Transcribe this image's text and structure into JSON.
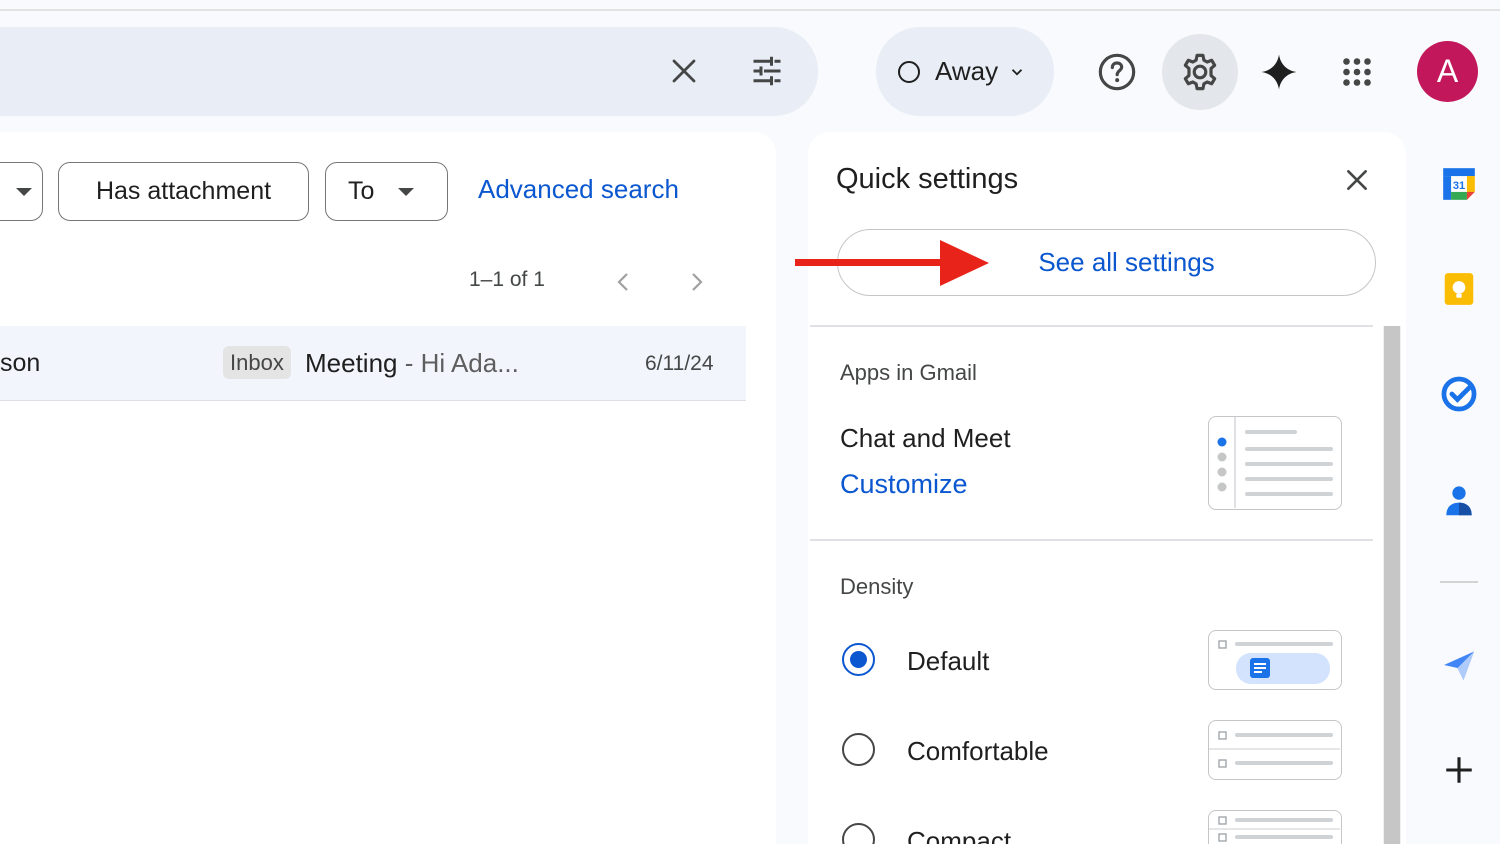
{
  "search": {
    "clear_icon": "close-icon",
    "options_icon": "tune-icon"
  },
  "status": {
    "label": "Away"
  },
  "header_icons": [
    "help-icon",
    "settings-gear-icon",
    "gemini-spark-icon",
    "apps-grid-icon"
  ],
  "account": {
    "avatar_letter": "A",
    "avatar_color": "#c2185b"
  },
  "filters": {
    "cut_chip_label": "",
    "has_attachment": "Has attachment",
    "to": "To",
    "advanced_search": "Advanced search"
  },
  "pager": {
    "text": "1–1 of 1"
  },
  "mail": {
    "sender": "son",
    "label": "Inbox",
    "subject": "Meeting",
    "snippet": " - Hi Ada...",
    "date": "6/11/24"
  },
  "quick_settings": {
    "title": "Quick settings",
    "see_all": "See all settings",
    "apps_section": "Apps in Gmail",
    "chat_meet": "Chat and Meet",
    "customize": "Customize",
    "density_section": "Density",
    "density_options": [
      {
        "label": "Default",
        "selected": true
      },
      {
        "label": "Comfortable",
        "selected": false
      },
      {
        "label": "Compact",
        "selected": false
      }
    ]
  },
  "side_panel": [
    "calendar-icon",
    "keep-icon",
    "tasks-icon",
    "contacts-icon",
    "send-icon",
    "add-icon"
  ],
  "calendar_day": "31",
  "colors": {
    "accent": "#0b57d0",
    "annotation_arrow": "#e8241a"
  }
}
